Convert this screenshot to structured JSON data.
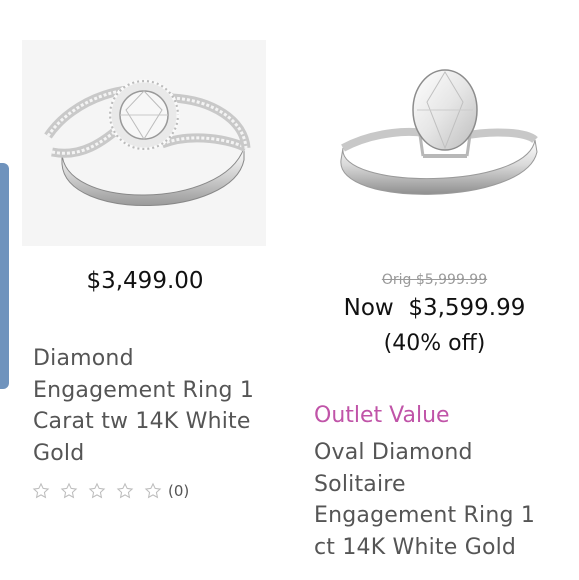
{
  "products": [
    {
      "price": "$3,499.00",
      "title": "Diamond Engagement Ring 1 Carat tw 14K White Gold",
      "rating_count": "(0)",
      "image_icon": "ring-halo-split-shank-icon"
    },
    {
      "orig_price": "Orig  $5,999.99",
      "now_price": "Now  $3,599.99",
      "discount": "(40% off)",
      "badge": "Outlet Value",
      "badge_color": "#c054a8",
      "title": "Oval Diamond Solitaire Engagement Ring 1 ct 14K White Gold",
      "image_icon": "ring-oval-solitaire-icon"
    }
  ],
  "colors": {
    "edge_tab": "#6f93bd"
  }
}
